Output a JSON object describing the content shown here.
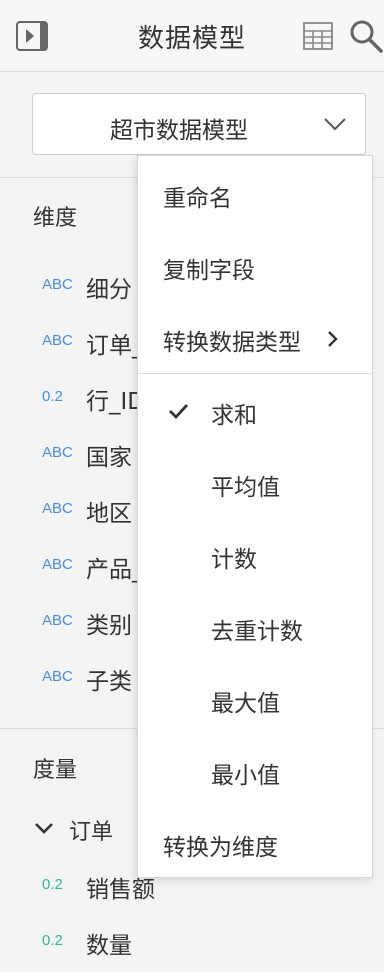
{
  "header": {
    "title": "数据模型",
    "icons": [
      "panel-toggle-icon",
      "table-grid-icon",
      "search-icon"
    ]
  },
  "model_selector": {
    "value": "超市数据模型"
  },
  "dimensions": {
    "title": "维度",
    "items": [
      {
        "type": "ABC",
        "name": "细分"
      },
      {
        "type": "ABC",
        "name": "订单_"
      },
      {
        "type": "0.2",
        "name": "行_ID"
      },
      {
        "type": "ABC",
        "name": "国家"
      },
      {
        "type": "ABC",
        "name": "地区"
      },
      {
        "type": "ABC",
        "name": "产品_"
      },
      {
        "type": "ABC",
        "name": "类别"
      },
      {
        "type": "ABC",
        "name": "子类"
      }
    ]
  },
  "measures": {
    "title": "度量",
    "group": "订单",
    "items": [
      {
        "type": "0.2",
        "name": "销售额"
      },
      {
        "type": "0.2",
        "name": "数量"
      }
    ]
  },
  "context_menu": {
    "rename": "重命名",
    "copy_field": "复制字段",
    "convert_type": "转换数据类型",
    "aggregations": [
      "求和",
      "平均值",
      "计数",
      "去重计数",
      "最大值",
      "最小值"
    ],
    "selected_aggregation": "求和",
    "to_dimension": "转换为维度"
  },
  "colors": {
    "text_type_dimension": "#4a8fd8",
    "numeric_type_measure": "#2eb89e",
    "background": "#f4f4f4"
  }
}
